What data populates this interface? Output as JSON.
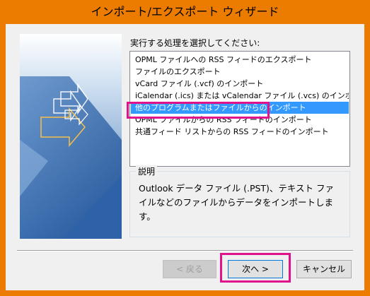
{
  "window": {
    "title": "インポート/エクスポート ウィザード"
  },
  "prompt": "実行する処理を選択してください:",
  "actions": [
    "OPML ファイルへの RSS フィードのエクスポート",
    "ファイルのエクスポート",
    "vCard ファイル (.vcf) のインポート",
    "iCalendar (.ics) または vCalendar ファイル (.vcs) のインポート",
    "他のプログラムまたはファイルからのインポート",
    "OPML ファイルからの RSS フィードのインポート",
    "共通フィード リストからの RSS フィードのインポート"
  ],
  "selected_index": 4,
  "description": {
    "legend": "説明",
    "text": "Outlook データ ファイル (.PST)、テキスト ファイルなどのファイルからデータをインポートします。"
  },
  "buttons": {
    "back": "< 戻る",
    "next": "次へ >",
    "cancel": "キャンセル"
  },
  "colors": {
    "title_bar": "#ec7c00",
    "selection": "#3399ff",
    "annotation": "#e0138c"
  }
}
